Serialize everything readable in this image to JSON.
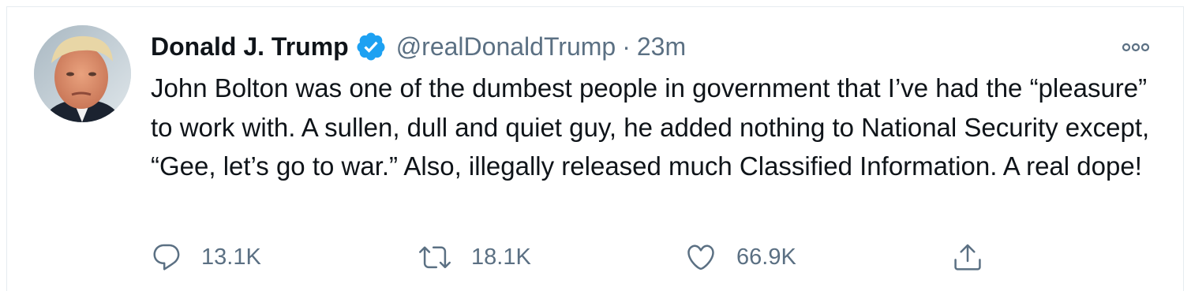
{
  "tweet": {
    "author": {
      "display_name": "Donald J. Trump",
      "handle": "@realDonaldTrump",
      "verified": true
    },
    "separator": "·",
    "time": "23m",
    "text": "John Bolton was one of the dumbest people in government that I’ve had the “pleasure” to work with. A sullen, dull and quiet guy, he added nothing to National Security except, “Gee, let’s go to war.” Also, illegally released much Classified Information. A real dope!",
    "actions": {
      "reply": {
        "icon": "reply-icon",
        "count": "13.1K"
      },
      "retweet": {
        "icon": "retweet-icon",
        "count": "18.1K"
      },
      "like": {
        "icon": "heart-icon",
        "count": "66.9K"
      },
      "share": {
        "icon": "share-icon"
      }
    },
    "more_icon": "more-icon"
  },
  "colors": {
    "text_primary": "#0f1419",
    "text_secondary": "#5b7083",
    "verified_blue": "#1da1f2",
    "border": "#e6ecf0"
  }
}
